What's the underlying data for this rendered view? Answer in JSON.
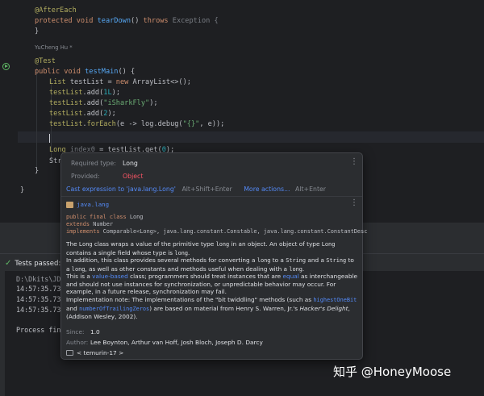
{
  "editor": {
    "lines": [
      {
        "segments": [
          {
            "c": "an",
            "t": "@AfterEach"
          }
        ]
      },
      {
        "segments": [
          {
            "c": "kw",
            "t": "protected void "
          },
          {
            "c": "fn",
            "t": "tearDown"
          },
          {
            "c": "pu",
            "t": "() "
          },
          {
            "c": "kw",
            "t": "throws "
          },
          {
            "c": "gr",
            "t": "Exception {"
          }
        ]
      },
      {
        "segments": [
          {
            "c": "pu",
            "t": "}"
          }
        ]
      },
      {
        "segments": [
          {
            "c": "an",
            "t": "@Test"
          }
        ]
      },
      {
        "segments": [
          {
            "c": "kw",
            "t": "public void "
          },
          {
            "c": "fn",
            "t": "testMain"
          },
          {
            "c": "pu",
            "t": "() {"
          }
        ]
      },
      {
        "segments": [
          {
            "c": "an",
            "t": "List"
          },
          {
            "c": "pu",
            "t": " testList = "
          },
          {
            "c": "kw",
            "t": "new "
          },
          {
            "c": "pu",
            "t": "ArrayList<>();"
          }
        ]
      },
      {
        "segments": [
          {
            "c": "an",
            "t": "testList"
          },
          {
            "c": "pu",
            "t": ".add("
          },
          {
            "c": "nu",
            "t": "1L"
          },
          {
            "c": "pu",
            "t": ");"
          }
        ]
      },
      {
        "segments": [
          {
            "c": "an",
            "t": "testList"
          },
          {
            "c": "pu",
            "t": ".add("
          },
          {
            "c": "st",
            "t": "\"iSharkFly\""
          },
          {
            "c": "pu",
            "t": ");"
          }
        ]
      },
      {
        "segments": [
          {
            "c": "an",
            "t": "testList"
          },
          {
            "c": "pu",
            "t": ".add("
          },
          {
            "c": "nu",
            "t": "2"
          },
          {
            "c": "pu",
            "t": ");"
          }
        ]
      },
      {
        "segments": [
          {
            "c": "an",
            "t": "testList"
          },
          {
            "c": "pu",
            "t": "."
          },
          {
            "c": "an",
            "t": "forEach"
          },
          {
            "c": "pu",
            "t": "(e -> log.debug("
          },
          {
            "c": "st",
            "t": "\"{}\""
          },
          {
            "c": "pu",
            "t": ", e));"
          }
        ]
      },
      {
        "segments": [
          {
            "c": "pu",
            "t": ""
          }
        ]
      },
      {
        "segments": [
          {
            "c": "an",
            "t": "Long"
          },
          {
            "c": "gr",
            "t": " index0"
          },
          {
            "c": "pu",
            "t": " = testList.get("
          },
          {
            "c": "nu",
            "t": "0"
          },
          {
            "c": "pu",
            "t": ");"
          }
        ]
      },
      {
        "segments": [
          {
            "c": "pu",
            "t": "Str"
          }
        ]
      },
      {
        "segments": [
          {
            "c": "pu",
            "t": "}"
          }
        ]
      },
      {
        "segments": [
          {
            "c": "pu",
            "t": "}"
          }
        ]
      }
    ],
    "author_hint": "YuCheng Hu *"
  },
  "popup": {
    "required_type_label": "Required type:",
    "required_type_value": "Long",
    "provided_label": "Provided:",
    "provided_value": "Object",
    "quickfix_action": "Cast expression to 'java.lang.Long'",
    "quickfix_shortcut": "Alt+Shift+Enter",
    "more_actions": "More actions...",
    "more_actions_shortcut": "Alt+Enter",
    "package": "java.lang",
    "decl_line1_kw": "public final class ",
    "decl_line1_name": "Long",
    "decl_line2_kw": "extends ",
    "decl_line2_name": "Number",
    "decl_line3_kw": "implements ",
    "decl_line3_name": "Comparable<Long>, java.lang.constant.Constable, java.lang.constant.ConstantDesc",
    "para1": [
      {
        "t": "The "
      },
      {
        "t": "Long",
        "code": true
      },
      {
        "t": " class wraps a value of the primitive type "
      },
      {
        "t": "long",
        "code": true
      },
      {
        "t": " in an object. An object of type "
      },
      {
        "t": "Long",
        "code": true
      },
      {
        "t": " contains a single field whose type is "
      },
      {
        "t": "long",
        "code": true
      },
      {
        "t": "."
      }
    ],
    "para2": [
      {
        "t": "In addition, this class provides several methods for converting a "
      },
      {
        "t": "long",
        "code": true
      },
      {
        "t": " to a "
      },
      {
        "t": "String",
        "code": true
      },
      {
        "t": " and a "
      },
      {
        "t": "String",
        "code": true
      },
      {
        "t": " to a "
      },
      {
        "t": "long",
        "code": true
      },
      {
        "t": ", as well as other constants and methods useful when dealing with a "
      },
      {
        "t": "long",
        "code": true
      },
      {
        "t": "."
      }
    ],
    "para3": [
      {
        "t": "This is a "
      },
      {
        "t": "value-based",
        "link": true
      },
      {
        "t": " class; programmers should treat instances that are "
      },
      {
        "t": "equal",
        "link": true
      },
      {
        "t": " as interchangeable and should not use instances for synchronization, or unpredictable behavior may occur. For example, in a future release, synchronization may fail."
      }
    ],
    "para4": [
      {
        "t": "Implementation note: The implementations of the \"bit twiddling\" methods (such as "
      },
      {
        "t": "highestOneBit",
        "link": true,
        "code": true
      },
      {
        "t": " and "
      },
      {
        "t": "numberOfTrailingZeros",
        "link": true,
        "code": true
      },
      {
        "t": ") are based on material from Henry S. Warren, Jr.'s "
      },
      {
        "t": "Hacker's Delight",
        "ital": true
      },
      {
        "t": ", (Addison Wesley, 2002)."
      }
    ],
    "since_label": "Since:",
    "since_value": "1.0",
    "author_label": "Author:",
    "author_value": "Lee Boynton, Arthur van Hoff, Josh Bloch, Joseph D. Darcy",
    "sdk": "< temurin-17 >"
  },
  "run_panel": {
    "status": "Tests passed: 1",
    "log_lines": [
      "D:\\Dkits\\JDK\\",
      "14:57:35.731 [",
      "14:57:35.733 [",
      "14:57:35.733 [",
      "",
      "Process finis"
    ]
  },
  "watermark": "知乎 @HoneyMoose"
}
